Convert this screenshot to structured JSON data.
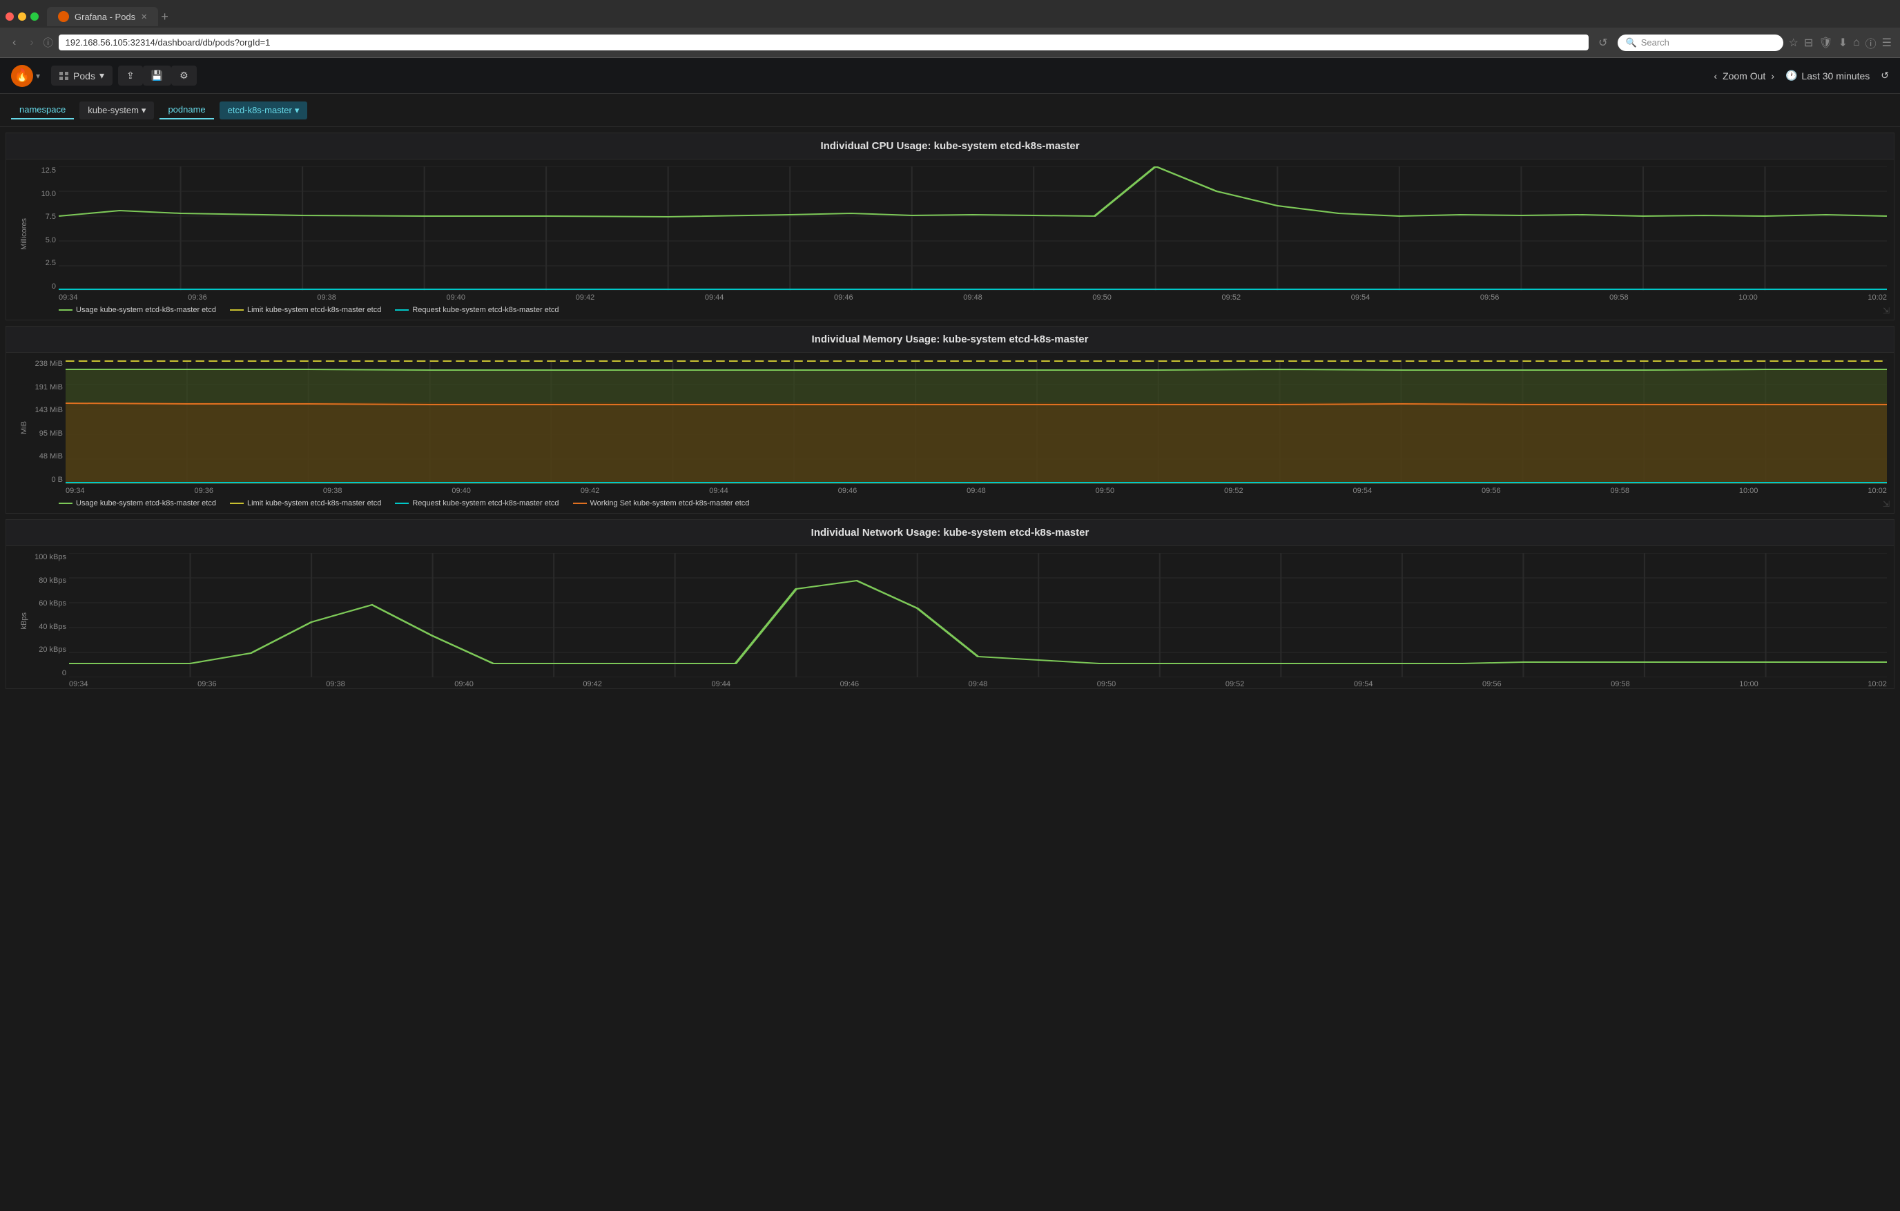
{
  "browser": {
    "tab_title": "Grafana - Pods",
    "url": "192.168.56.105:32314/dashboard/db/pods?orgId=1",
    "search_placeholder": "Search",
    "nav_back": "‹",
    "nav_forward": "›",
    "nav_info": "ⓘ",
    "reload": "↺"
  },
  "header": {
    "logo_icon": "🔥",
    "dashboard_name": "Pods",
    "share_icon": "share",
    "save_icon": "save",
    "settings_icon": "settings",
    "zoom_out": "Zoom Out",
    "time_range": "Last 30 minutes"
  },
  "filters": {
    "namespace_label": "namespace",
    "kube_system_label": "kube-system",
    "podname_label": "podname",
    "etcd_label": "etcd-k8s-master"
  },
  "cpu_chart": {
    "title": "Individual CPU Usage: kube-system etcd-k8s-master",
    "y_axis_label": "Millicores",
    "y_labels": [
      "12.5",
      "10.0",
      "7.5",
      "5.0",
      "2.5",
      "0"
    ],
    "x_labels": [
      "09:34",
      "09:36",
      "09:38",
      "09:40",
      "09:42",
      "09:44",
      "09:46",
      "09:48",
      "09:50",
      "09:52",
      "09:54",
      "09:56",
      "09:58",
      "10:00",
      "10:02"
    ],
    "legend": [
      {
        "label": "Usage kube-system etcd-k8s-master etcd",
        "color": "#7dc958"
      },
      {
        "label": "Limit kube-system etcd-k8s-master etcd",
        "color": "#c8c030"
      },
      {
        "label": "Request kube-system etcd-k8s-master etcd",
        "color": "#00c8c8"
      }
    ]
  },
  "memory_chart": {
    "title": "Individual Memory Usage: kube-system etcd-k8s-master",
    "y_axis_label": "MiB",
    "y_labels": [
      "238 MiB",
      "191 MiB",
      "143 MiB",
      "95 MiB",
      "48 MiB",
      "0 B"
    ],
    "x_labels": [
      "09:34",
      "09:36",
      "09:38",
      "09:40",
      "09:42",
      "09:44",
      "09:46",
      "09:48",
      "09:50",
      "09:52",
      "09:54",
      "09:56",
      "09:58",
      "10:00",
      "10:02"
    ],
    "legend": [
      {
        "label": "Usage kube-system etcd-k8s-master etcd",
        "color": "#7dc958"
      },
      {
        "label": "Limit kube-system etcd-k8s-master etcd",
        "color": "#c8c030"
      },
      {
        "label": "Request kube-system etcd-k8s-master etcd",
        "color": "#00c8c8"
      },
      {
        "label": "Working Set kube-system etcd-k8s-master etcd",
        "color": "#e07020"
      }
    ]
  },
  "network_chart": {
    "title": "Individual Network Usage: kube-system etcd-k8s-master",
    "y_axis_label": "kBps",
    "y_labels": [
      "100 kBps",
      "80 kBps",
      "60 kBps",
      "40 kBps",
      "20 kBps",
      "0"
    ],
    "x_labels": [
      "09:34",
      "09:36",
      "09:38",
      "09:40",
      "09:42",
      "09:44",
      "09:46",
      "09:48",
      "09:50",
      "09:52",
      "09:54",
      "09:56",
      "09:58",
      "10:00",
      "10:02"
    ]
  }
}
